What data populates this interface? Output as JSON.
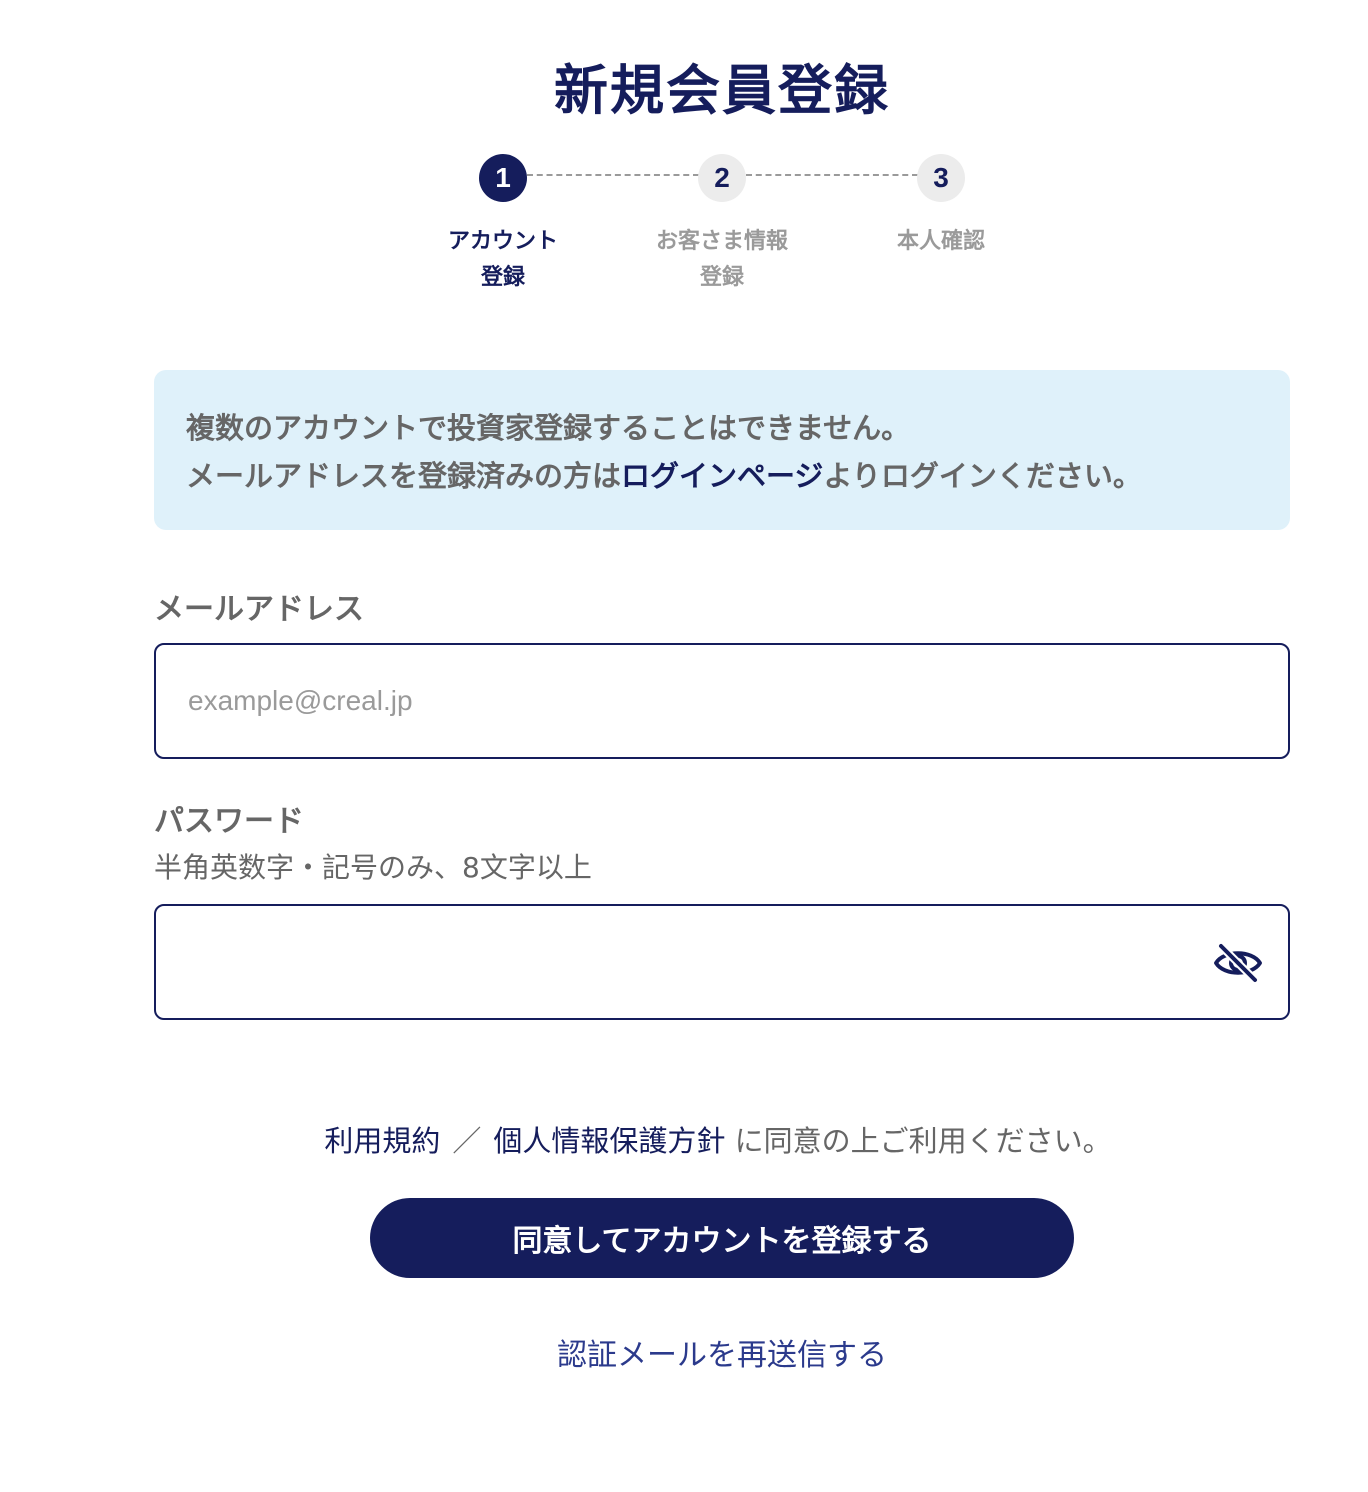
{
  "page": {
    "title": "新規会員登録"
  },
  "stepper": {
    "steps": [
      {
        "number": "1",
        "label": "アカウント\n登録",
        "state": "active"
      },
      {
        "number": "2",
        "label": "お客さま情報\n登録",
        "state": "inactive"
      },
      {
        "number": "3",
        "label": "本人確認",
        "state": "inactive"
      }
    ]
  },
  "notice": {
    "line1": "複数のアカウントで投資家登録することはできません。",
    "line2_before": "メールアドレスを登録済みの方は",
    "line2_link": "ログインページ",
    "line2_after": "よりログインください。"
  },
  "email": {
    "label": "メールアドレス",
    "placeholder": "example@creal.jp",
    "value": ""
  },
  "password": {
    "label": "パスワード",
    "hint": "半角英数字・記号のみ、8文字以上",
    "value": "",
    "toggle_icon": "eye-off-icon"
  },
  "agreement": {
    "terms_link": "利用規約",
    "separator": "／",
    "privacy_link": "個人情報保護方針",
    "suffix": "に同意の上ご利用ください。"
  },
  "actions": {
    "submit_label": "同意してアカウントを登録する",
    "resend_label": "認証メールを再送信する"
  },
  "colors": {
    "brand_navy": "#151d5c",
    "notice_bg": "#dff1fa",
    "text_gray": "#666666",
    "inactive_gray": "#9a9a9a"
  }
}
